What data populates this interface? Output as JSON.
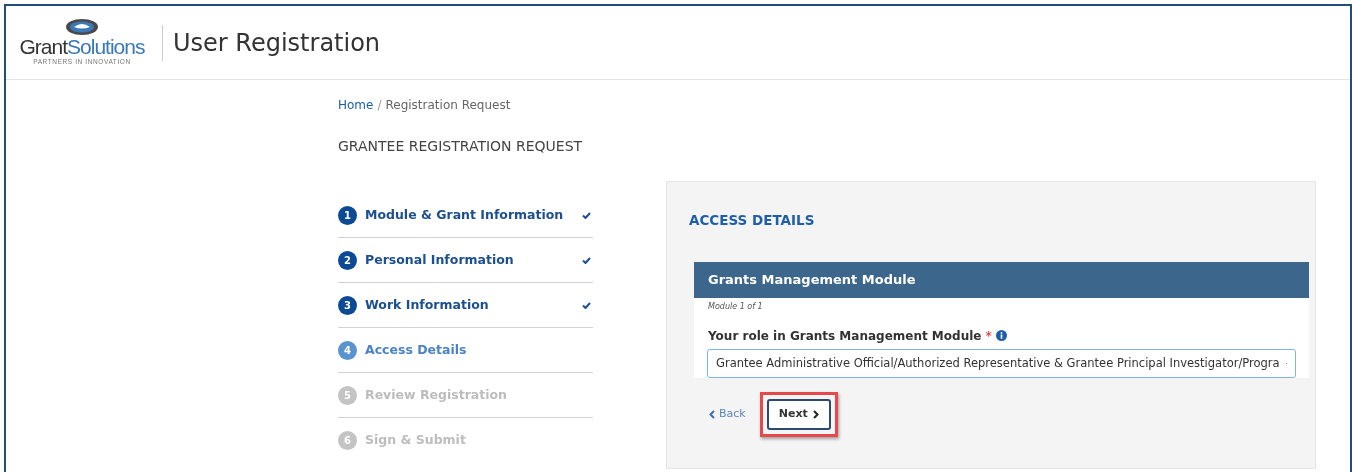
{
  "header": {
    "logo_name": "Grant",
    "logo_name_bold": "Solutions",
    "logo_tagline": "PARTNERS IN INNOVATION",
    "title": "User Registration"
  },
  "breadcrumb_separator": "/",
  "breadcrumb": [
    {
      "label": "Home",
      "link": true
    },
    {
      "label": "Registration Request",
      "link": false
    }
  ],
  "page_title": "GRANTEE REGISTRATION REQUEST",
  "steps": [
    {
      "number": "1",
      "label": "Module & Grant Information",
      "completed": true,
      "selected": false,
      "disabled": false
    },
    {
      "number": "2",
      "label": "Personal Information",
      "completed": true,
      "selected": false,
      "disabled": false
    },
    {
      "number": "3",
      "label": "Work Information",
      "completed": true,
      "selected": false,
      "disabled": false
    },
    {
      "number": "4",
      "label": "Access Details",
      "completed": false,
      "selected": true,
      "disabled": false
    },
    {
      "number": "5",
      "label": "Review Registration",
      "completed": false,
      "selected": false,
      "disabled": true
    },
    {
      "number": "6",
      "label": "Sign & Submit",
      "completed": false,
      "selected": false,
      "disabled": true
    }
  ],
  "panel": {
    "title": "ACCESS DETAILS",
    "module": {
      "header": "Grants Management Module",
      "subtitle": "Module 1 of 1",
      "field_label": "Your role in Grants Management Module",
      "required_mark": "*",
      "value": "Grantee Administrative Official/Authorized Representative & Grantee Principal Investigator/Progra"
    }
  },
  "actions": {
    "back": "Back",
    "next": "Next",
    "next_highlighted": true
  }
}
